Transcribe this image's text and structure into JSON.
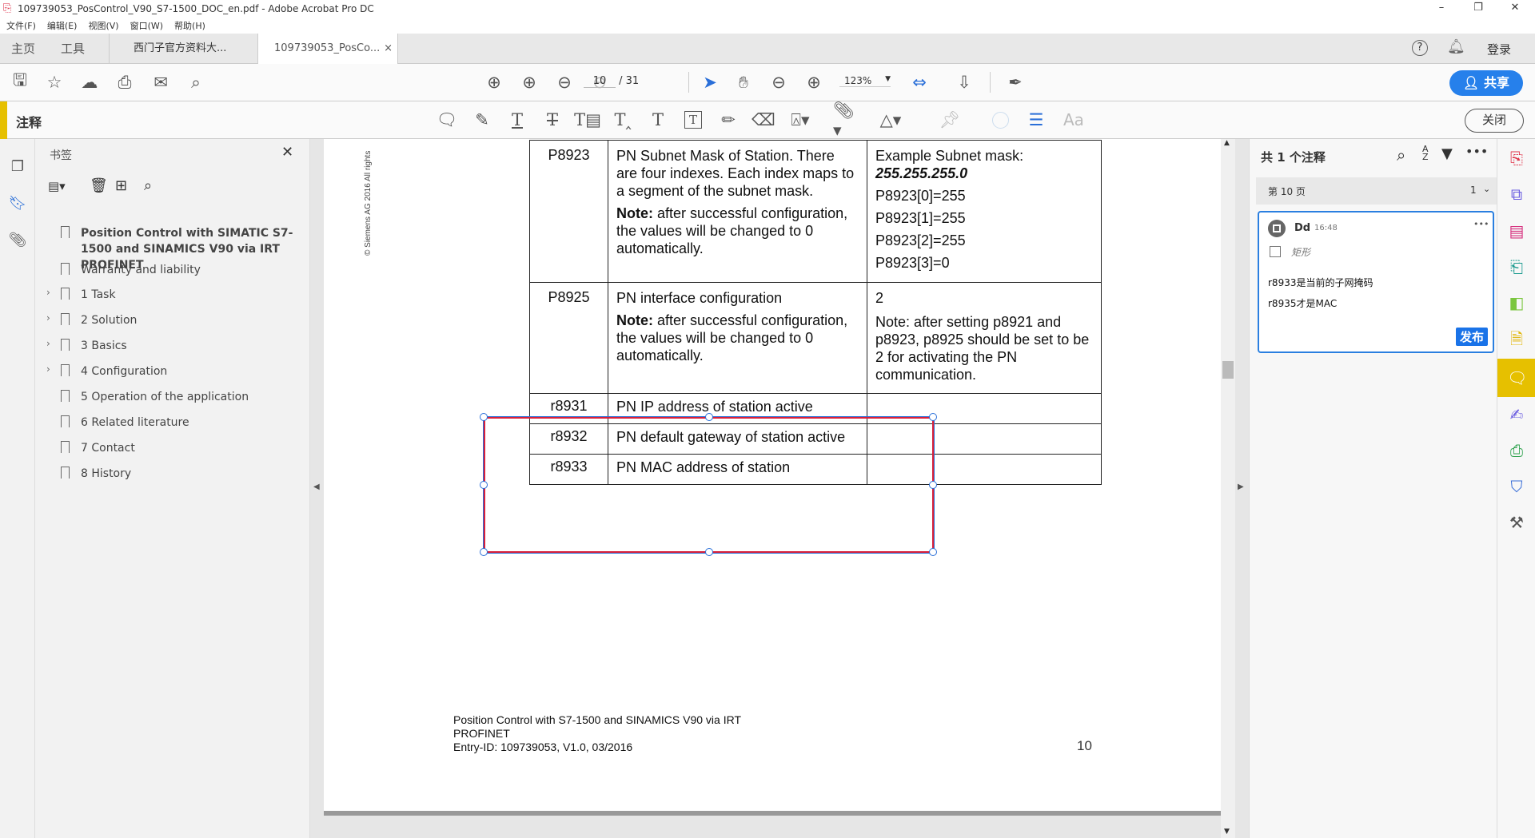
{
  "window": {
    "title": "109739053_PosControl_V90_S7-1500_DOC_en.pdf - Adobe Acrobat Pro DC",
    "minimize": "–",
    "maximize": "❐",
    "close": "✕"
  },
  "menu": [
    "文件(F)",
    "编辑(E)",
    "视图(V)",
    "窗口(W)",
    "帮助(H)"
  ],
  "tabs": {
    "home": "主页",
    "tools": "工具",
    "doc1": "西门子官方资料大...",
    "doc2": "109739053_PosCo...",
    "close": "×",
    "login": "登录"
  },
  "toolbar": {
    "page_current": "10",
    "page_total": "/ 31",
    "zoom": "123%",
    "share": "共享"
  },
  "commentbar": {
    "title": "注释",
    "font_button": "Aa",
    "close": "关闭"
  },
  "bookmarks": {
    "title": "书签",
    "items": [
      {
        "label": "Position Control with SIMATIC S7-1500 and SINAMICS V90 via IRT PROFINET",
        "expand": false
      },
      {
        "label": "Warranty and liability",
        "expand": false
      },
      {
        "label": "1 Task",
        "expand": true
      },
      {
        "label": "2 Solution",
        "expand": true
      },
      {
        "label": "3 Basics",
        "expand": true
      },
      {
        "label": "4 Configuration",
        "expand": true
      },
      {
        "label": "5 Operation of the application",
        "expand": false
      },
      {
        "label": "6 Related literature",
        "expand": false
      },
      {
        "label": "7 Contact",
        "expand": false
      },
      {
        "label": "8 History",
        "expand": false
      }
    ]
  },
  "document": {
    "copyright": "© Siemens AG 2016 All rights",
    "rows": [
      {
        "param": "P8923",
        "desc": "PN Subnet Mask of Station. There are four indexes. Each index maps to a segment of the subnet mask.",
        "note_label": "Note:",
        "note": " after successful configuration, the values will be changed to 0 automatically.",
        "value_lines": [
          "Example Subnet mask:"
        ],
        "value_bold": "255.255.255.0",
        "value_extra": [
          "P8923[0]=255",
          "P8923[1]=255",
          "P8923[2]=255",
          "P8923[3]=0"
        ]
      },
      {
        "param": "P8925",
        "desc": "PN interface configuration",
        "note_label": "Note:",
        "note": " after successful configuration, the values will be changed to 0 automatically.",
        "value_lines": [
          "2"
        ],
        "value_extra": [
          "Note: after setting p8921 and p8923, p8925 should be set to be 2 for activating the PN communication."
        ]
      },
      {
        "param": "r8931",
        "desc": "PN IP address of station active"
      },
      {
        "param": "r8932",
        "desc": "PN default gateway of station active"
      },
      {
        "param": "r8933",
        "desc": "PN MAC address of station"
      }
    ],
    "footer": [
      "Position Control with  S7-1500 and SINAMICS V90 via IRT",
      "PROFINET",
      "Entry-ID: 109739053,    V1.0,     03/2016"
    ],
    "page_number": "10"
  },
  "comments": {
    "header": "共 1 个注释",
    "page_label": "第 10 页",
    "page_count": "1",
    "item": {
      "author": "Dd",
      "time": "16:48",
      "type": "矩形",
      "lines": [
        "r8933是当前的子网掩码",
        "r8935才是MAC"
      ],
      "publish": "发布"
    }
  },
  "colors": {
    "accent": "#2680eb",
    "annot_red": "#d9203a",
    "mode_yellow": "#e6c000"
  }
}
